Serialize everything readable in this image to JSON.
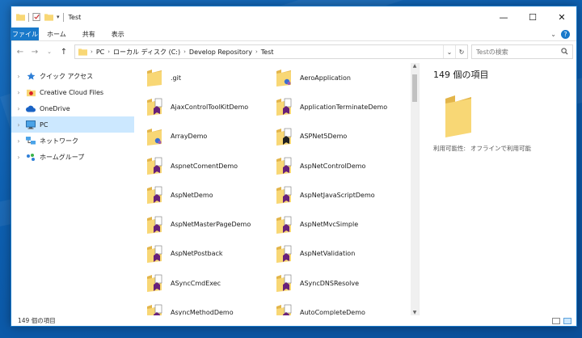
{
  "window": {
    "title": "Test",
    "controls": {
      "minimize": "—",
      "maximize": "☐",
      "close": "✕"
    }
  },
  "ribbon": {
    "tabs": [
      "ファイル",
      "ホーム",
      "共有",
      "表示"
    ],
    "expand_icon": "chevron-down-icon",
    "help": "?"
  },
  "address": {
    "crumbs": [
      "PC",
      "ローカル ディスク (C:)",
      "Develop Repository",
      "Test"
    ],
    "search_placeholder": "Testの検索"
  },
  "nav": {
    "items": [
      {
        "label": "クイック アクセス",
        "icon": "star-icon",
        "selected": false
      },
      {
        "label": "Creative Cloud Files",
        "icon": "creative-cloud-icon",
        "selected": false
      },
      {
        "label": "OneDrive",
        "icon": "cloud-icon",
        "selected": false
      },
      {
        "label": "PC",
        "icon": "computer-icon",
        "selected": true
      },
      {
        "label": "ネットワーク",
        "icon": "network-icon",
        "selected": false
      },
      {
        "label": "ホームグループ",
        "icon": "homegroup-icon",
        "selected": false
      }
    ]
  },
  "files": [
    {
      "name": ".git",
      "kind": "folder-plain"
    },
    {
      "name": "AeroApplication",
      "kind": "folder-solution"
    },
    {
      "name": "AjaxControlToolKitDemo",
      "kind": "folder-vs"
    },
    {
      "name": "ApplicationTerminateDemo",
      "kind": "folder-vs"
    },
    {
      "name": "ArrayDemo",
      "kind": "folder-solution"
    },
    {
      "name": "ASPNet5Demo",
      "kind": "folder-vs-dark"
    },
    {
      "name": "AspnetComentDemo",
      "kind": "folder-vs"
    },
    {
      "name": "AspNetControlDemo",
      "kind": "folder-vs"
    },
    {
      "name": "AspNetDemo",
      "kind": "folder-vs"
    },
    {
      "name": "AspNetJavaScriptDemo",
      "kind": "folder-vs"
    },
    {
      "name": "AspNetMasterPageDemo",
      "kind": "folder-vs"
    },
    {
      "name": "AspNetMvcSimple",
      "kind": "folder-vs"
    },
    {
      "name": "AspNetPostback",
      "kind": "folder-vs"
    },
    {
      "name": "AspNetValidation",
      "kind": "folder-vs"
    },
    {
      "name": "ASyncCmdExec",
      "kind": "folder-vs"
    },
    {
      "name": "ASyncDNSResolve",
      "kind": "folder-vs"
    },
    {
      "name": "AsyncMethodDemo",
      "kind": "folder-vs"
    },
    {
      "name": "AutoCompleteDemo",
      "kind": "folder-vs"
    }
  ],
  "preview": {
    "count": "149 個の項目",
    "avail_label": "利用可能性:",
    "avail_value": "オフラインで利用可能"
  },
  "status": {
    "count": "149 個の項目"
  },
  "colors": {
    "accent": "#1979ca",
    "folder": "#f8d775",
    "vs_purple": "#68217a",
    "selection": "#cce8ff"
  }
}
